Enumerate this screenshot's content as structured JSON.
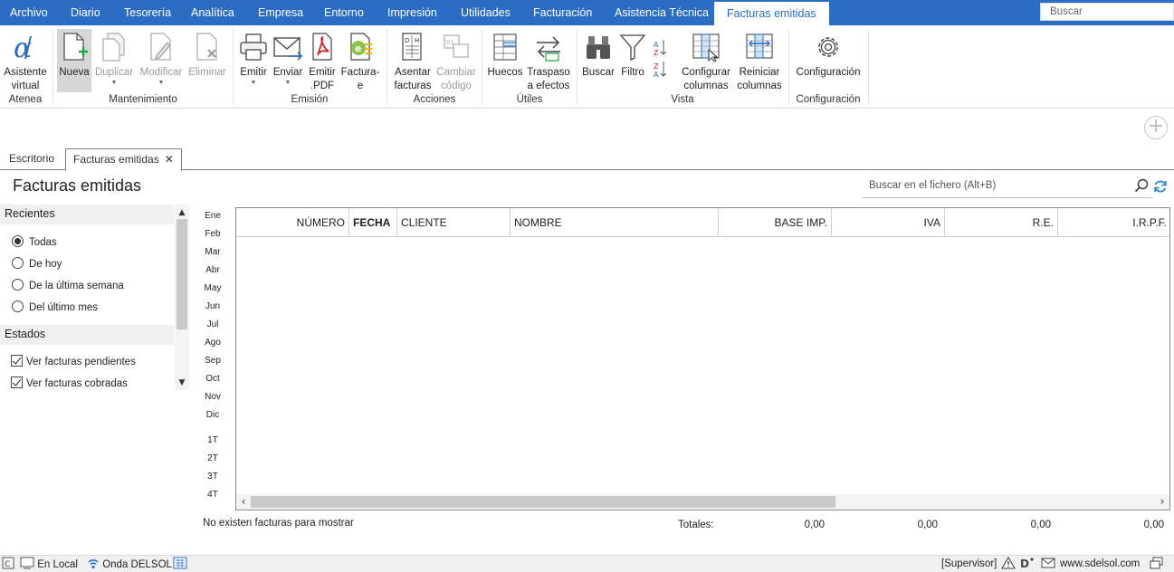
{
  "menu": {
    "tabs": [
      {
        "label": "Archivo"
      },
      {
        "label": "Diario"
      },
      {
        "label": "Tesorería"
      },
      {
        "label": "Analítica"
      },
      {
        "label": "Empresa"
      },
      {
        "label": "Entorno"
      },
      {
        "label": "Impresión"
      },
      {
        "label": "Utilidades"
      },
      {
        "label": "Facturación"
      },
      {
        "label": "Asistencia Técnica"
      },
      {
        "label": "Facturas emitidas"
      }
    ],
    "active_tab": "Facturas emitidas",
    "search_placeholder": "Buscar",
    "accent_color": "#2b6cc4"
  },
  "ribbon": {
    "buttons": {
      "asistente": {
        "line1": "Asistente",
        "line2": "virtual",
        "icon": "alpha-icon"
      },
      "nueva": {
        "line1": "Nueva",
        "icon": "new-document-icon"
      },
      "duplicar": {
        "line1": "Duplicar",
        "icon": "duplicate-icon"
      },
      "modificar": {
        "line1": "Modificar",
        "icon": "edit-document-icon"
      },
      "eliminar": {
        "line1": "Eliminar",
        "icon": "delete-document-icon"
      },
      "emitir": {
        "line1": "Emitir",
        "icon": "printer-icon"
      },
      "enviar": {
        "line1": "Enviar",
        "icon": "envelope-icon"
      },
      "emitir_pdf": {
        "line1": "Emitir",
        "line2": ".PDF",
        "icon": "pdf-icon"
      },
      "facturae": {
        "line1": "Factura-",
        "line2": "e",
        "icon": "facturae-icon"
      },
      "asentar": {
        "line1": "Asentar",
        "line2": "facturas",
        "icon": "ledger-icon"
      },
      "cambiar": {
        "line1": "Cambiar",
        "line2": "código",
        "icon": "change-code-icon"
      },
      "huecos": {
        "line1": "Huecos",
        "icon": "gaps-icon"
      },
      "traspaso": {
        "line1": "Traspaso",
        "line2": "a efectos",
        "icon": "transfer-icon"
      },
      "buscar": {
        "line1": "Buscar",
        "icon": "binoculars-icon"
      },
      "filtro": {
        "line1": "Filtro",
        "icon": "filter-icon"
      },
      "configurar": {
        "line1": "Configurar",
        "line2": "columnas",
        "icon": "columns-config-icon"
      },
      "reiniciar": {
        "line1": "Reiniciar",
        "line2": "columnas",
        "icon": "columns-reset-icon"
      },
      "configuracion": {
        "line1": "Configuración",
        "icon": "gear-icon"
      }
    },
    "groups": {
      "atenea": "Atenea",
      "mantenimiento": "Mantenimiento",
      "emision": "Emisión",
      "acciones": "Acciones",
      "utiles": "Útiles",
      "vista": "Vista",
      "configuracion": "Configuración"
    }
  },
  "doc_tabs": {
    "escritorio": "Escritorio",
    "facturas": "Facturas emitidas"
  },
  "page": {
    "title": "Facturas emitidas",
    "file_search_placeholder": "Buscar en el fichero (Alt+B)"
  },
  "left_panel": {
    "recientes": {
      "title": "Recientes",
      "options": [
        "Todas",
        "De hoy",
        "De la última semana",
        "Del último mes"
      ],
      "selected": "Todas"
    },
    "estados": {
      "title": "Estados",
      "checks": [
        {
          "label": "Ver facturas pendientes",
          "checked": true
        },
        {
          "label": "Ver facturas cobradas",
          "checked": true
        }
      ]
    }
  },
  "months": [
    "Ene",
    "Feb",
    "Mar",
    "Abr",
    "May",
    "Jun",
    "Jul",
    "Ago",
    "Sep",
    "Oct",
    "Nov",
    "Dic"
  ],
  "quarters": [
    "1T",
    "2T",
    "3T",
    "4T"
  ],
  "grid": {
    "columns": [
      "NÚMERO",
      "FECHA",
      "CLIENTE",
      "NOMBRE",
      "BASE IMP.",
      "IVA",
      "R.E.",
      "I.R.P.F."
    ],
    "sorted_column": "FECHA",
    "rows": []
  },
  "footer": {
    "empty_message": "No existen facturas para mostrar",
    "totals_label": "Totales:",
    "totals": [
      "0,00",
      "0,00",
      "0,00",
      "0,00"
    ]
  },
  "statusbar": {
    "local": "En Local",
    "onda": "Onda DELSOL",
    "user": "[Supervisor]",
    "website": "www.sdelsol.com"
  }
}
